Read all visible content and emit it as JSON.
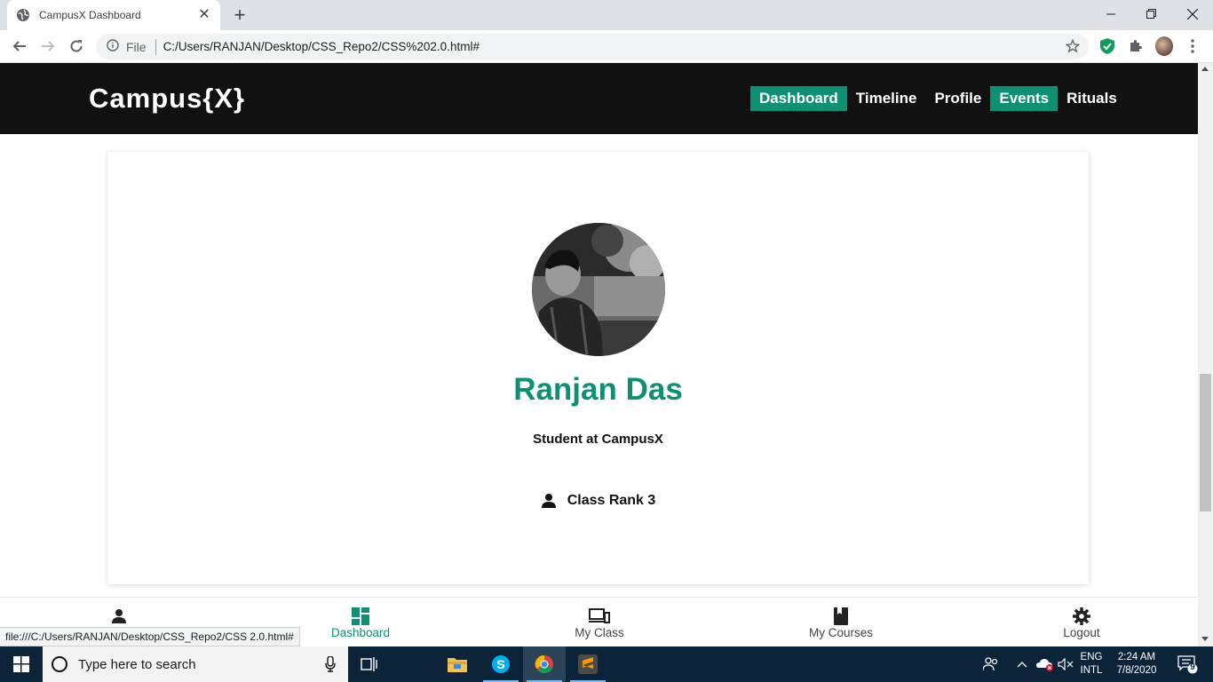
{
  "browser": {
    "tab_title": "CampusX Dashboard",
    "new_tab": "+",
    "file_label": "File",
    "url": "C:/Users/RANJAN/Desktop/CSS_Repo2/CSS%202.0.html#",
    "status_url": "file:///C:/Users/RANJAN/Desktop/CSS_Repo2/CSS 2.0.html#"
  },
  "site": {
    "brand": "Campus{X}",
    "accent_color": "#0e9073",
    "nav": [
      {
        "label": "Dashboard",
        "active": true
      },
      {
        "label": "Timeline",
        "active": false
      },
      {
        "label": "Profile",
        "active": false
      },
      {
        "label": "Events",
        "active": true
      },
      {
        "label": "Rituals",
        "active": false
      }
    ]
  },
  "profile": {
    "name": "Ranjan Das",
    "role": "Student at CampusX",
    "rank": "Class Rank 3"
  },
  "bottom_nav": [
    {
      "label": "",
      "icon": "person-icon",
      "active": false
    },
    {
      "label": "Dashboard",
      "icon": "dashboard-icon",
      "active": true
    },
    {
      "label": "My Class",
      "icon": "devices-icon",
      "active": false
    },
    {
      "label": "My Courses",
      "icon": "book-icon",
      "active": false
    },
    {
      "label": "Logout",
      "icon": "gear-icon",
      "active": false
    }
  ],
  "taskbar": {
    "search_placeholder": "Type here to search",
    "lang_top": "ENG",
    "lang_bottom": "INTL",
    "time": "2:24 AM",
    "date": "7/8/2020",
    "notifications": "9"
  }
}
